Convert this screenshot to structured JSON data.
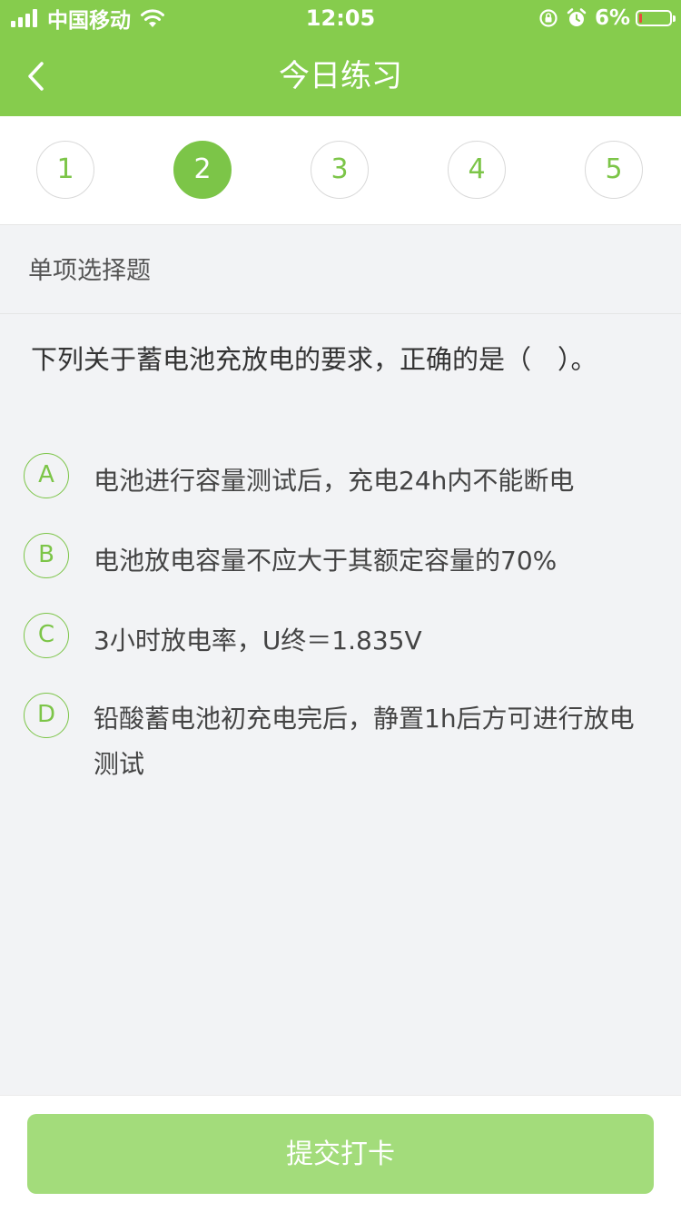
{
  "status_bar": {
    "carrier": "中国移动",
    "time": "12:05",
    "battery_percent": "6%",
    "battery_level": 0.06,
    "icons": [
      "signal-icon",
      "wifi-icon",
      "orientation-lock-icon",
      "alarm-icon",
      "battery-icon"
    ]
  },
  "nav": {
    "title": "今日练习",
    "back_icon": "chevron-left-icon"
  },
  "stepper": {
    "steps": [
      "1",
      "2",
      "3",
      "4",
      "5"
    ],
    "active_index": 1
  },
  "section": {
    "label": "单项选择题"
  },
  "question": {
    "text": "下列关于蓄电池充放电的要求，正确的是（　）。",
    "options": [
      {
        "letter": "A",
        "text": "电池进行容量测试后，充电24h内不能断电"
      },
      {
        "letter": "B",
        "text": "电池放电容量不应大于其额定容量的70%"
      },
      {
        "letter": "C",
        "text": "3小时放电率，U终＝1.835V"
      },
      {
        "letter": "D",
        "text": "铅酸蓄电池初充电完后，静置1h后方可进行放电测试"
      }
    ]
  },
  "footer": {
    "submit_label": "提交打卡"
  },
  "colors": {
    "brand_green": "#86cc4d",
    "accent_green": "#7cc548",
    "button_disabled_green": "#a3dc7b",
    "background": "#f2f3f5"
  }
}
